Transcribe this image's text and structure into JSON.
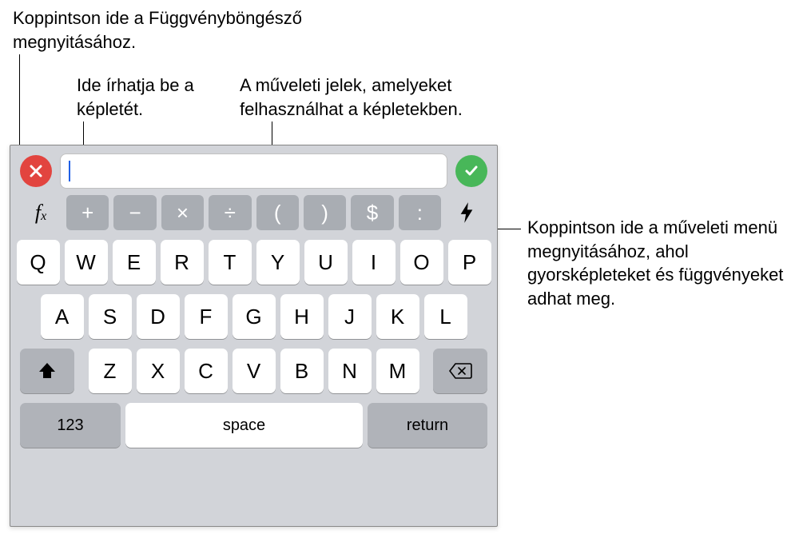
{
  "callouts": {
    "top_left": "Koppintson ide a Függvényböngésző megnyitásához.",
    "formula_input": "Ide írhatja be a képletét.",
    "operators": "A műveleti jelek, amelyeket felhasználhat a képletekben.",
    "lightning": "Koppintson ide a műveleti menü megnyitásához, ahol gyorsképleteket és függvényeket adhat meg."
  },
  "formula_bar": {
    "fx_label_main": "f",
    "fx_label_sub": "x",
    "operators": [
      "+",
      "−",
      "×",
      "÷",
      "(",
      ")",
      "$",
      ":"
    ]
  },
  "keyboard": {
    "row1": [
      "Q",
      "W",
      "E",
      "R",
      "T",
      "Y",
      "U",
      "I",
      "O",
      "P"
    ],
    "row2": [
      "A",
      "S",
      "D",
      "F",
      "G",
      "H",
      "J",
      "K",
      "L"
    ],
    "row3": [
      "Z",
      "X",
      "C",
      "V",
      "B",
      "N",
      "M"
    ],
    "numeric_label": "123",
    "space_label": "space",
    "return_label": "return"
  }
}
